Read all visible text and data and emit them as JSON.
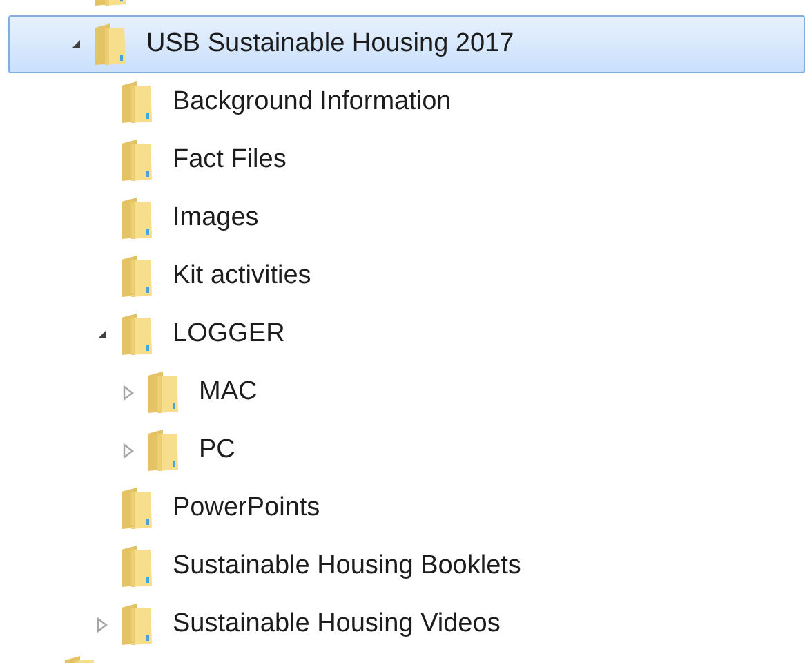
{
  "tree": [
    {
      "label": "USB Sustainable Housing 2017",
      "selected": true,
      "expanded": true,
      "children": [
        {
          "label": "Background Information",
          "selected": false
        },
        {
          "label": "Fact Files",
          "selected": false
        },
        {
          "label": "Images",
          "selected": false
        },
        {
          "label": "Kit activities",
          "selected": false
        },
        {
          "label": "LOGGER",
          "selected": false,
          "expanded": true,
          "children": [
            {
              "label": "MAC",
              "selected": false,
              "expanded": false
            },
            {
              "label": "PC",
              "selected": false,
              "expanded": false
            }
          ]
        },
        {
          "label": "PowerPoints",
          "selected": false
        },
        {
          "label": "Sustainable Housing Booklets",
          "selected": false
        },
        {
          "label": "Sustainable Housing Videos",
          "selected": false,
          "expanded": false
        }
      ]
    }
  ]
}
